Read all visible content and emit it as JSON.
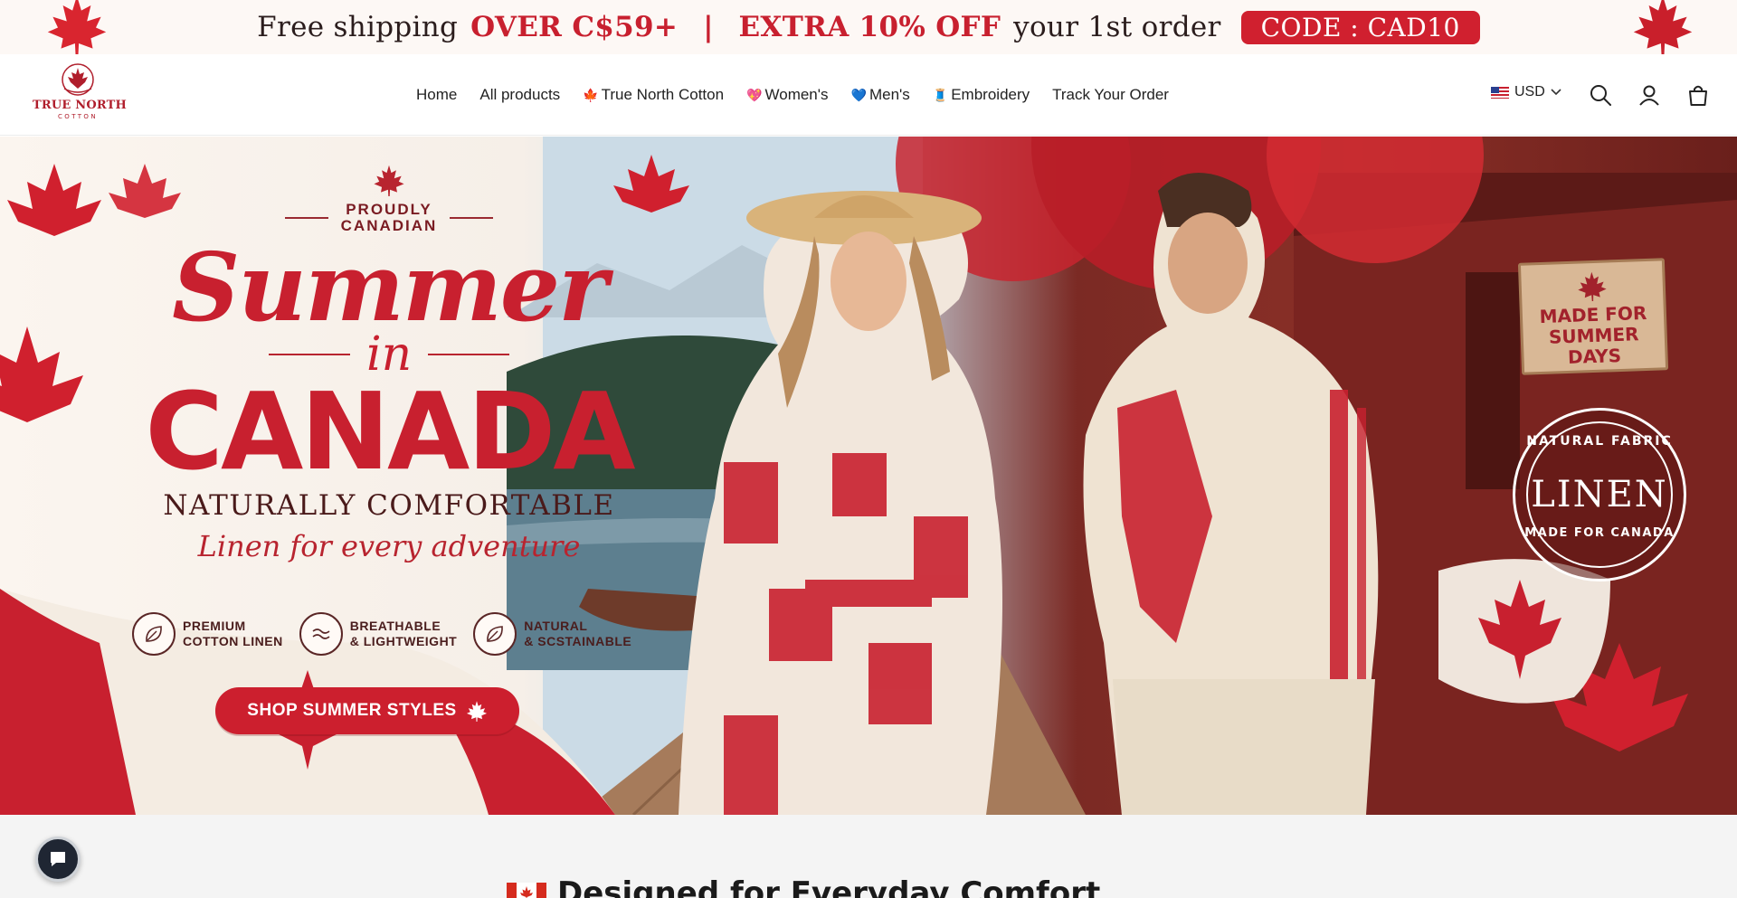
{
  "announcement": {
    "part1": "Free shipping",
    "part2": "OVER C$59+",
    "separator": "|",
    "part3": "EXTRA 10% OFF",
    "part4": "your 1st order",
    "code": "CODE :  CAD10"
  },
  "header": {
    "logo": {
      "brand": "TRUE NORTH",
      "sub": "COTTON"
    },
    "nav": [
      {
        "label": "Home",
        "emoji": ""
      },
      {
        "label": "All products",
        "emoji": ""
      },
      {
        "label": "True North Cotton",
        "emoji": "🍁"
      },
      {
        "label": "Women's",
        "emoji": "💖"
      },
      {
        "label": "Men's",
        "emoji": "💙"
      },
      {
        "label": "Embroidery",
        "emoji": "🧵"
      },
      {
        "label": "Track Your Order",
        "emoji": ""
      }
    ],
    "currency": "USD",
    "icons": [
      "search-icon",
      "account-icon",
      "cart-icon"
    ]
  },
  "hero": {
    "proudly": [
      "PROUDLY",
      "CANADIAN"
    ],
    "headline_script": "Summer",
    "headline_in": "in",
    "headline_main": "CANADA",
    "tagline": "NATURALLY COMFORTABLE",
    "subtag": "Linen for every adventure",
    "features": [
      {
        "line1": "PREMIUM",
        "line2": "COTTON LINEN",
        "icon": "leaf-icon"
      },
      {
        "line1": "BREATHABLE",
        "line2": "& LIGHTWEIGHT",
        "icon": "wind-icon"
      },
      {
        "line1": "NATURAL",
        "line2": "& SCSTAINABLE",
        "icon": "leaf-icon"
      }
    ],
    "cta": "SHOP SUMMER STYLES",
    "sign": [
      "MADE FOR",
      "SUMMER DAYS"
    ],
    "badge": {
      "top": "NATURAL FABRIC",
      "center": "LINEN",
      "bottom": "MADE FOR CANADA"
    }
  },
  "section": {
    "title": "Designed for Everyday Comfort"
  },
  "colors": {
    "accent": "#c8202f",
    "dark": "#4a1a1a",
    "chat": "#1f2633"
  }
}
